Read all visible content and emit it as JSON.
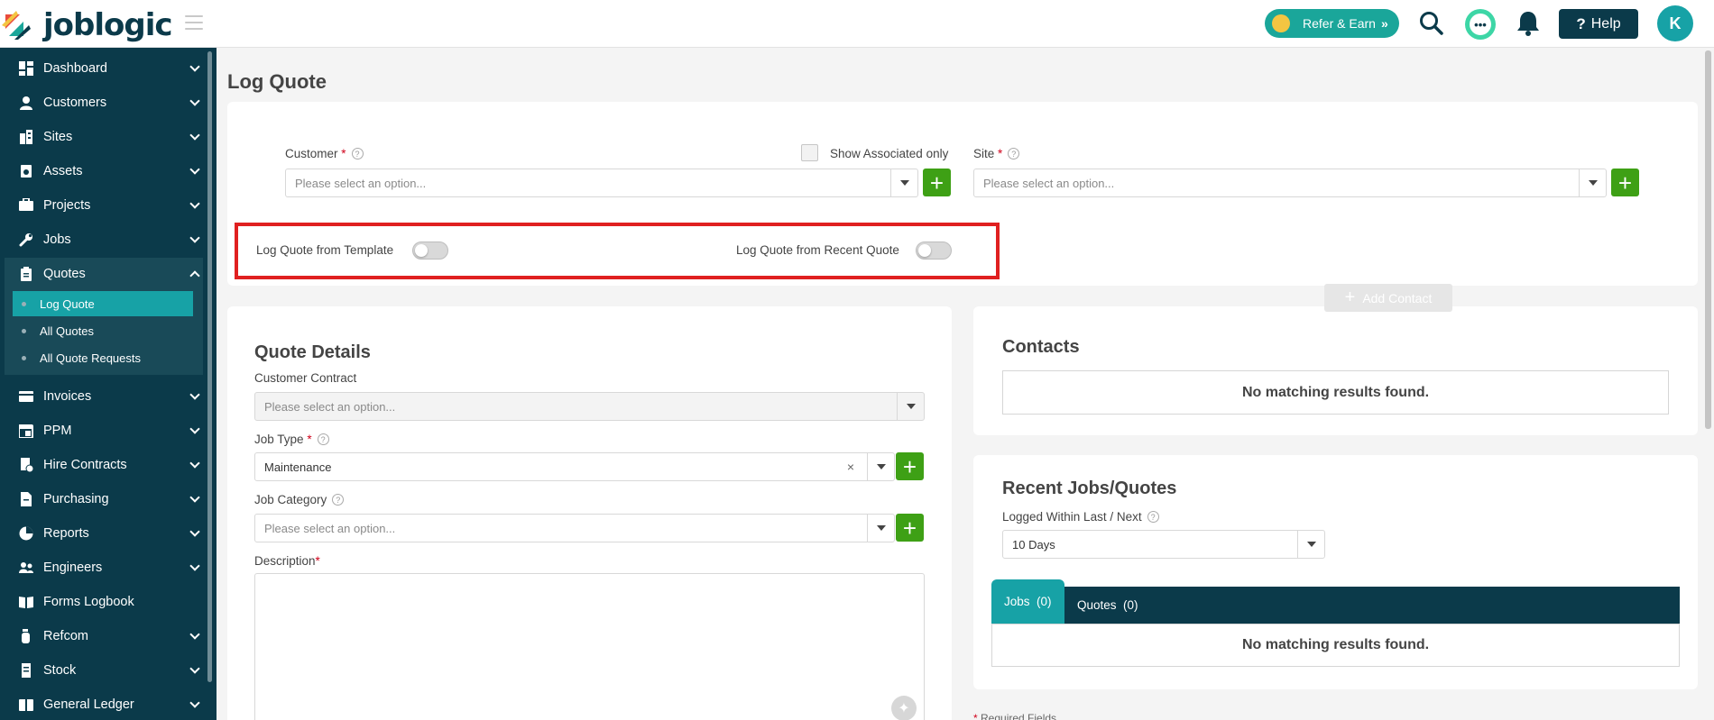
{
  "brand": {
    "name": "joblogic"
  },
  "topbar": {
    "refer_label": "Refer & Earn",
    "refer_arrows": "»",
    "help_label": "Help",
    "help_icon": "?",
    "avatar_initial": "K",
    "chat_glyph": "•••"
  },
  "sidebar": {
    "items": [
      {
        "label": "Dashboard",
        "icon": "dashboard-icon"
      },
      {
        "label": "Customers",
        "icon": "customer-icon"
      },
      {
        "label": "Sites",
        "icon": "building-icon"
      },
      {
        "label": "Assets",
        "icon": "asset-icon"
      },
      {
        "label": "Projects",
        "icon": "projects-icon"
      },
      {
        "label": "Jobs",
        "icon": "wrench-icon"
      },
      {
        "label": "Quotes",
        "icon": "clipboard-icon"
      },
      {
        "label": "Invoices",
        "icon": "invoice-icon"
      },
      {
        "label": "PPM",
        "icon": "calendar-icon"
      },
      {
        "label": "Hire Contracts",
        "icon": "contract-icon"
      },
      {
        "label": "Purchasing",
        "icon": "purchase-icon"
      },
      {
        "label": "Reports",
        "icon": "pie-chart-icon"
      },
      {
        "label": "Engineers",
        "icon": "people-icon"
      },
      {
        "label": "Forms Logbook",
        "icon": "book-icon"
      },
      {
        "label": "Refcom",
        "icon": "cylinder-icon"
      },
      {
        "label": "Stock",
        "icon": "stock-icon"
      },
      {
        "label": "General Ledger",
        "icon": "ledger-icon"
      }
    ],
    "quotes_sub": [
      {
        "label": "Log Quote",
        "active": true
      },
      {
        "label": "All Quotes",
        "active": false
      },
      {
        "label": "All Quote Requests",
        "active": false
      }
    ]
  },
  "page": {
    "title": "Log Quote"
  },
  "top_form": {
    "customer_label": "Customer",
    "customer_placeholder": "Please select an option...",
    "show_associated_label": "Show Associated only",
    "site_label": "Site",
    "site_placeholder": "Please select an option...",
    "required_mark": "*",
    "help_mark": "?",
    "plus": "+"
  },
  "toggles": {
    "from_template": "Log Quote from Template",
    "from_recent": "Log Quote from Recent Quote"
  },
  "quote_details": {
    "title": "Quote Details",
    "contract_label": "Customer Contract",
    "contract_placeholder": "Please select an option...",
    "job_type_label": "Job Type",
    "job_type_value": "Maintenance",
    "clear": "×",
    "job_category_label": "Job Category",
    "job_category_placeholder": "Please select an option...",
    "description_label": "Description",
    "ai_glyph": "✦"
  },
  "contacts": {
    "title": "Contacts",
    "add_label": "Add Contact",
    "add_plus": "+",
    "empty": "No matching results found."
  },
  "recent": {
    "title": "Recent Jobs/Quotes",
    "logged_label": "Logged Within Last / Next",
    "logged_value": "10 Days",
    "tabs": [
      {
        "label": "Jobs",
        "count": "(0)"
      },
      {
        "label": "Quotes",
        "count": "(0)"
      }
    ],
    "empty": "No matching results found."
  },
  "footer": {
    "required_note": "Required Fields"
  },
  "colors": {
    "sidebar": "#0b3a4a",
    "accent": "#17a2a6",
    "plus": "#3ea015",
    "highlight": "#e02020"
  }
}
